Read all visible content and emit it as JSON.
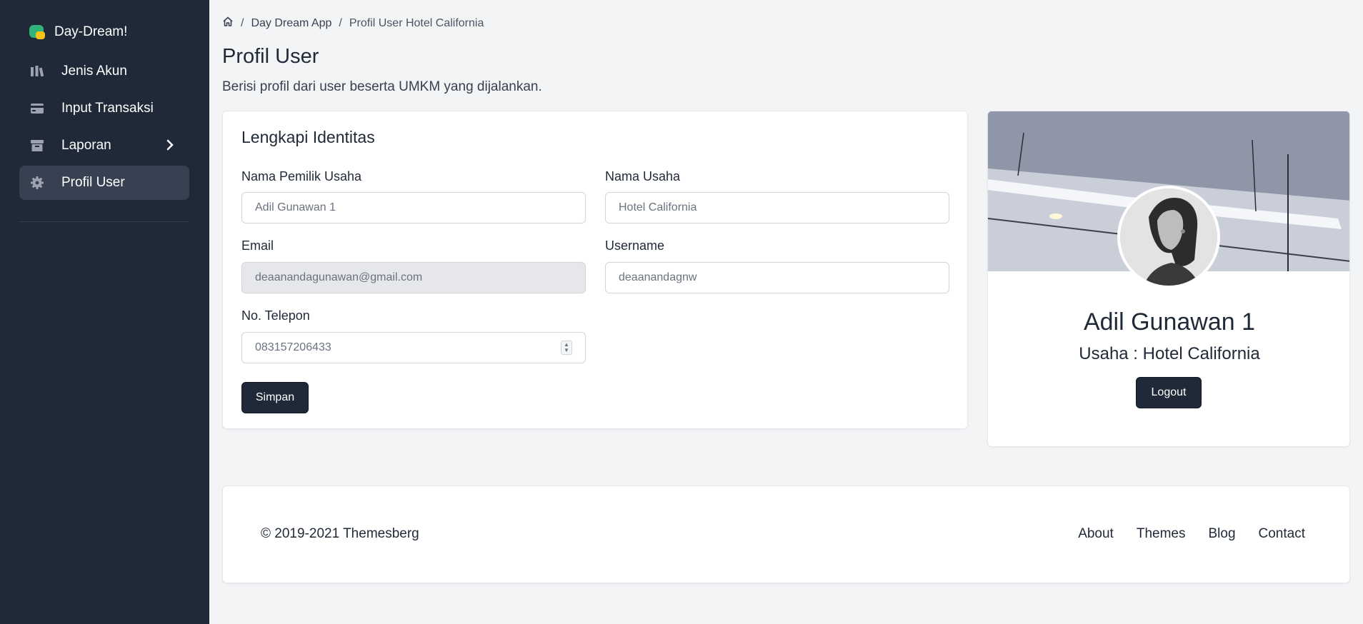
{
  "brand": {
    "name": "Day-Dream!"
  },
  "sidebar": {
    "items": [
      {
        "label": "Jenis Akun",
        "icon": "chart-bars-icon"
      },
      {
        "label": "Input Transaksi",
        "icon": "credit-card-icon"
      },
      {
        "label": "Laporan",
        "icon": "archive-icon"
      },
      {
        "label": "Profil User",
        "icon": "gear-icon"
      }
    ]
  },
  "breadcrumb": {
    "home_icon": "home-icon",
    "level1": "Day Dream App",
    "level2": "Profil User Hotel California",
    "separator": "/"
  },
  "header": {
    "title": "Profil User",
    "subtitle": "Berisi profil dari user beserta UMKM yang dijalankan."
  },
  "form": {
    "title": "Lengkapi Identitas",
    "owner_label": "Nama Pemilik Usaha",
    "owner_value": "Adil Gunawan 1",
    "business_label": "Nama Usaha",
    "business_value": "Hotel California",
    "email_label": "Email",
    "email_value": "deaanandagunawan@gmail.com",
    "username_label": "Username",
    "username_value": "deaanandagnw",
    "phone_label": "No. Telepon",
    "phone_value": "083157206433",
    "save_label": "Simpan"
  },
  "profile": {
    "name": "Adil Gunawan 1",
    "business": "Usaha : Hotel California",
    "logout_label": "Logout"
  },
  "footer": {
    "copyright": "© 2019-2021 Themesberg",
    "links": [
      "About",
      "Themes",
      "Blog",
      "Contact"
    ]
  },
  "colors": {
    "sidebar_bg": "#1f2937",
    "active_item_bg": "#374151",
    "button_bg": "#1f2937",
    "page_bg": "#f2f4f6"
  }
}
